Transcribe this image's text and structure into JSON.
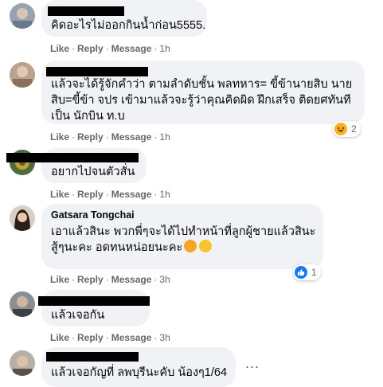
{
  "actions": {
    "like": "Like",
    "reply": "Reply",
    "message": "Message"
  },
  "comments": [
    {
      "name": "",
      "text": "คิดอะไรไม่ออกกินน้ำก่อน5555.",
      "time": "1h"
    },
    {
      "name": "",
      "text": "แล้วจะได้รู้จักคำว่า ตามลำดับชั้น พลทหาร= ขี้ข้านายสิบ นาย\nสิบ=ขี้ข้า จปร เข้ามาแล้วจะรู้ว่าคุณคิดผิด ฝึกเสร็จ ติดยศทันที\nเป็น นักบิน ท.บ",
      "time": "1h",
      "reaction_count": "2",
      "reaction_icon": "haha-icon"
    },
    {
      "name": "",
      "text": "อยากไปจนตัวสั่น",
      "time": "1h"
    },
    {
      "name": "Gatsara Tongchai",
      "text": "เอาแล้วสินะ พวกพี่ๆจะได้ไปทำหน้าที่ลูกผู้ชายแล้วสินะ\nสู้ๆนะคะ อดทนหน่อยนะคะ",
      "time": "3h",
      "reaction_count": "1",
      "reaction_icon": "like-icon"
    },
    {
      "name": "",
      "text": "แล้วเจอกัน",
      "time": "3h"
    },
    {
      "name": "",
      "text": "แล้วเจอกัญที่ ลพบุรีนะคับ น้องๆ1/64",
      "time": ""
    }
  ],
  "more_options": "..."
}
